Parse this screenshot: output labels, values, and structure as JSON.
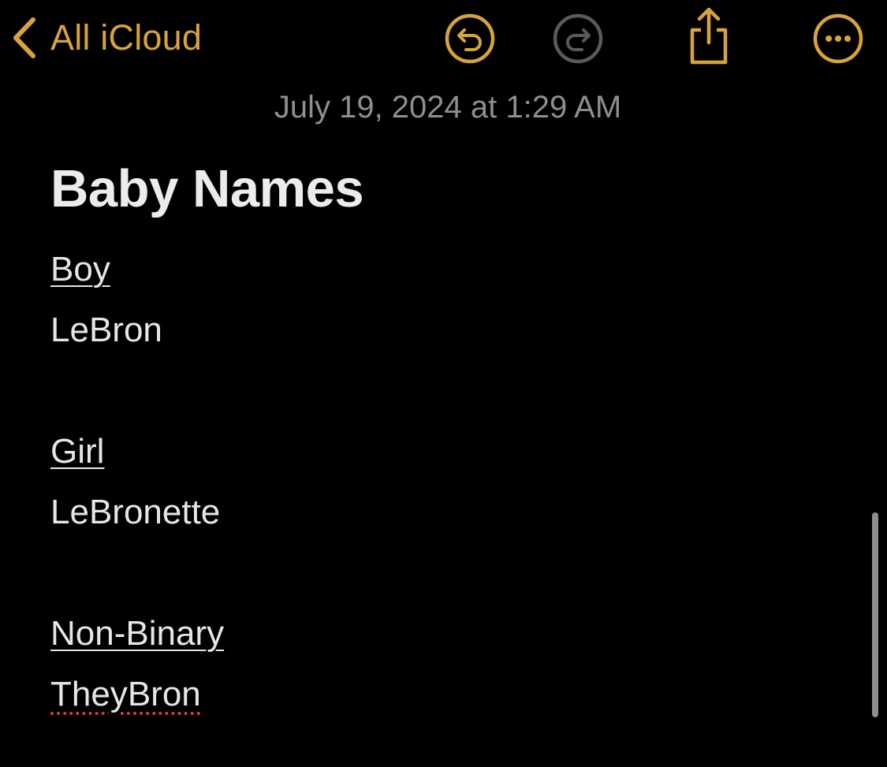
{
  "toolbar": {
    "back_label": "All iCloud",
    "back_icon": "chevron-left-icon",
    "undo_icon": "undo-icon",
    "redo_icon": "redo-icon",
    "share_icon": "share-icon",
    "more_icon": "more-icon",
    "accent_color": "#d8a43a",
    "disabled_color": "#5a5a5e"
  },
  "note": {
    "date": "July 19, 2024 at 1:29 AM",
    "title": "Baby Names",
    "lines": [
      "Boy",
      "LeBron",
      "",
      "Girl",
      "LeBronette",
      "",
      "Non-Binary",
      "TheyBron"
    ]
  },
  "colors": {
    "background": "#000000",
    "text": "#e6e6e6",
    "date_text": "#8e8e93",
    "spellcheck": "#e53935"
  }
}
